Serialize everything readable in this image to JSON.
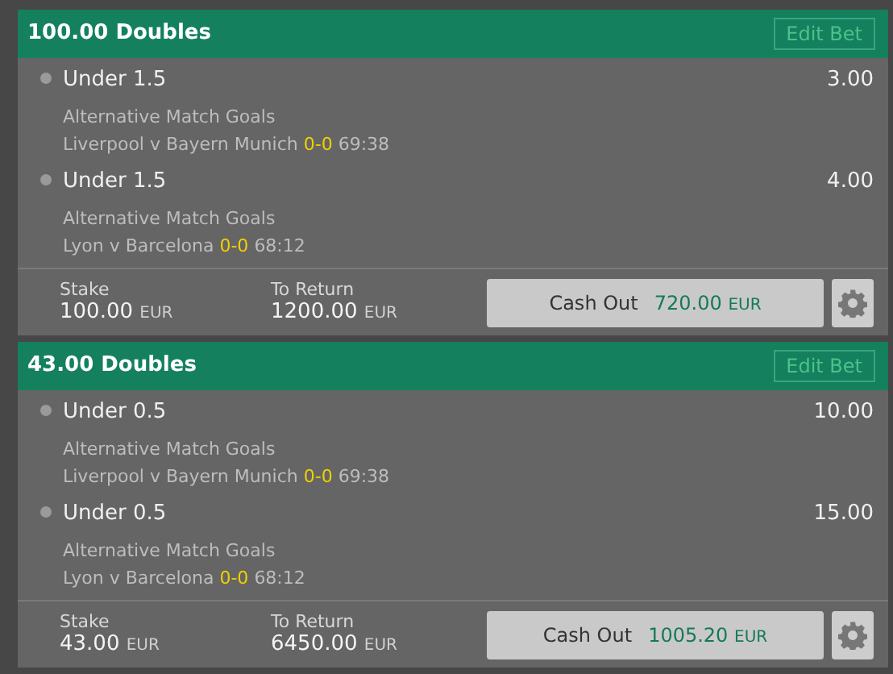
{
  "bets": [
    {
      "title": "100.00 Doubles",
      "edit_label": "Edit Bet",
      "legs": [
        {
          "selection": "Under 1.5",
          "odds": "3.00",
          "market": "Alternative Match Goals",
          "match": "Liverpool v Bayern Munich",
          "score": "0-0",
          "clock": "69:38"
        },
        {
          "selection": "Under 1.5",
          "odds": "4.00",
          "market": "Alternative Match Goals",
          "match": "Lyon v Barcelona",
          "score": "0-0",
          "clock": "68:12"
        }
      ],
      "stake_label": "Stake",
      "stake": "100.00",
      "stake_currency": "EUR",
      "return_label": "To Return",
      "return": "1200.00",
      "return_currency": "EUR",
      "cashout_label": "Cash Out",
      "cashout_amount": "720.00",
      "cashout_currency": "EUR"
    },
    {
      "title": "43.00 Doubles",
      "edit_label": "Edit Bet",
      "legs": [
        {
          "selection": "Under 0.5",
          "odds": "10.00",
          "market": "Alternative Match Goals",
          "match": "Liverpool v Bayern Munich",
          "score": "0-0",
          "clock": "69:38"
        },
        {
          "selection": "Under 0.5",
          "odds": "15.00",
          "market": "Alternative Match Goals",
          "match": "Lyon v Barcelona",
          "score": "0-0",
          "clock": "68:12"
        }
      ],
      "stake_label": "Stake",
      "stake": "43.00",
      "stake_currency": "EUR",
      "return_label": "To Return",
      "return": "6450.00",
      "return_currency": "EUR",
      "cashout_label": "Cash Out",
      "cashout_amount": "1005.20",
      "cashout_currency": "EUR"
    }
  ]
}
